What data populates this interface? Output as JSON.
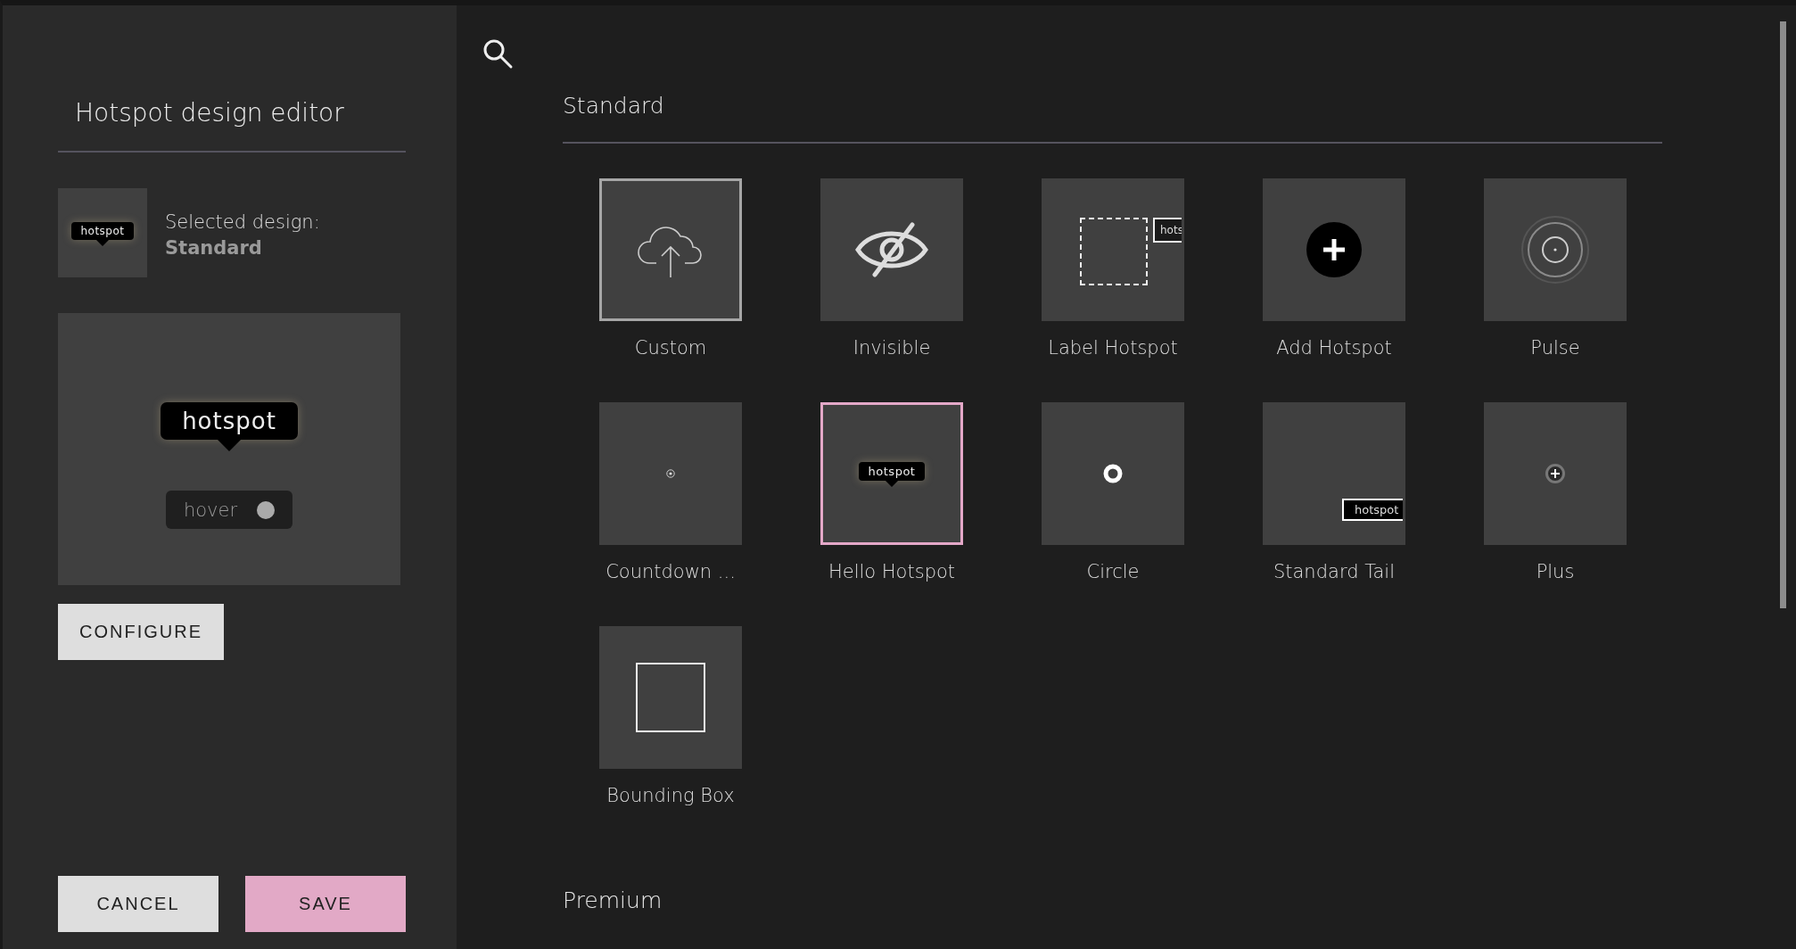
{
  "editor": {
    "title": "Hotspot design editor",
    "selected_label": "Selected design:",
    "selected_name": "Standard",
    "thumbnail_text": "hotspot",
    "preview": {
      "tooltip_text": "hotspot",
      "hover_toggle": {
        "label": "hover",
        "on": false
      }
    },
    "configure_button": "CONFIGURE",
    "cancel_button": "CANCEL",
    "save_button": "SAVE"
  },
  "gallery": {
    "sections": [
      {
        "title": "Standard",
        "tiles": [
          {
            "label": "Custom",
            "kind": "upload",
            "selected": false,
            "hovered": true
          },
          {
            "label": "Invisible",
            "kind": "invisible",
            "selected": false,
            "hovered": false
          },
          {
            "label": "Label Hotspot",
            "kind": "label",
            "tag_text": "hots",
            "selected": false,
            "hovered": false
          },
          {
            "label": "Add Hotspot",
            "kind": "add",
            "selected": false,
            "hovered": false
          },
          {
            "label": "Pulse",
            "kind": "pulse",
            "selected": false,
            "hovered": false
          },
          {
            "label": "Countdown ...",
            "kind": "countdown",
            "selected": false,
            "hovered": false
          },
          {
            "label": "Hello Hotspot",
            "kind": "tooltip",
            "tag_text": "hotspot",
            "selected": true,
            "hovered": false
          },
          {
            "label": "Circle",
            "kind": "circle",
            "selected": false,
            "hovered": false
          },
          {
            "label": "Standard Tail",
            "kind": "tail",
            "tag_text": "hotspot",
            "selected": false,
            "hovered": false
          },
          {
            "label": "Plus",
            "kind": "plus",
            "selected": false,
            "hovered": false
          },
          {
            "label": "Bounding Box",
            "kind": "bbox",
            "selected": false,
            "hovered": false
          }
        ]
      },
      {
        "title": "Premium"
      }
    ]
  }
}
